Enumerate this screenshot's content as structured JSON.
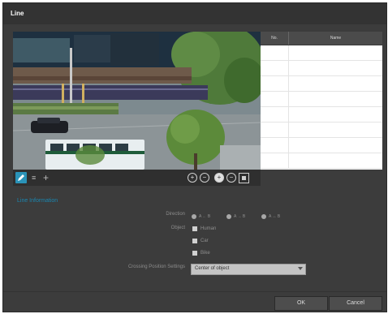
{
  "window": {
    "title": "Line"
  },
  "list_grid": {
    "columns": [
      "No.",
      "Name"
    ],
    "rows": [
      [
        "",
        ""
      ],
      [
        "",
        ""
      ],
      [
        "",
        ""
      ],
      [
        "",
        ""
      ],
      [
        "",
        ""
      ],
      [
        "",
        ""
      ],
      [
        "",
        ""
      ],
      [
        "",
        ""
      ]
    ]
  },
  "toolbar": {
    "draw_tool": "pencil-icon",
    "list_tool": "list-icon",
    "move_tool": "crosshair-icon",
    "zoom_buttons": [
      "zoom-in-icon",
      "zoom-out-icon",
      "zoom-in-icon",
      "zoom-out-icon"
    ],
    "fit_tool": "fit-window-icon",
    "accent": "#2a93b8"
  },
  "line_information": {
    "section_title": "Line Information",
    "direction": {
      "label": "Direction",
      "options": [
        "A ← B",
        "A → B",
        "A ↔ B"
      ]
    },
    "object": {
      "label": "Object",
      "options": [
        "Human",
        "Car",
        "Bike"
      ]
    },
    "crossing_position": {
      "label": "Crossing Position Settings",
      "selected": "Center of object"
    }
  },
  "buttons": {
    "ok": "OK",
    "cancel": "Cancel"
  }
}
